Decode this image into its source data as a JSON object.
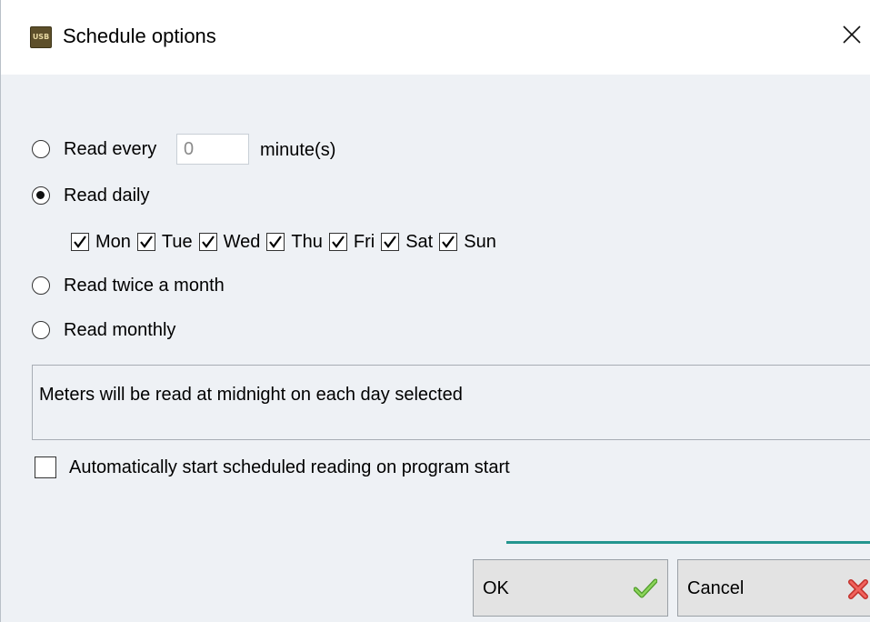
{
  "window": {
    "title": "Schedule options",
    "app_icon_text": "USB"
  },
  "schedule": {
    "read_every_label": "Read every",
    "minutes_value": "0",
    "minutes_unit": "minute(s)",
    "read_daily_label": "Read daily",
    "read_twice_monthly_label": "Read twice a month",
    "read_monthly_label": "Read monthly",
    "selected_option": "Read daily",
    "days": [
      {
        "label": "Mon",
        "checked": true
      },
      {
        "label": "Tue",
        "checked": true
      },
      {
        "label": "Wed",
        "checked": true
      },
      {
        "label": "Thu",
        "checked": true
      },
      {
        "label": "Fri",
        "checked": true
      },
      {
        "label": "Sat",
        "checked": true
      },
      {
        "label": "Sun",
        "checked": true
      }
    ]
  },
  "info": {
    "text": "Meters will be read at midnight on each day selected"
  },
  "auto_start": {
    "label": "Automatically start scheduled reading on program start",
    "checked": false
  },
  "buttons": {
    "ok_label": "OK",
    "cancel_label": "Cancel"
  },
  "colors": {
    "accent_line": "#23958f",
    "ok_icon": "#6cbb3c",
    "cancel_icon": "#e0403a"
  }
}
